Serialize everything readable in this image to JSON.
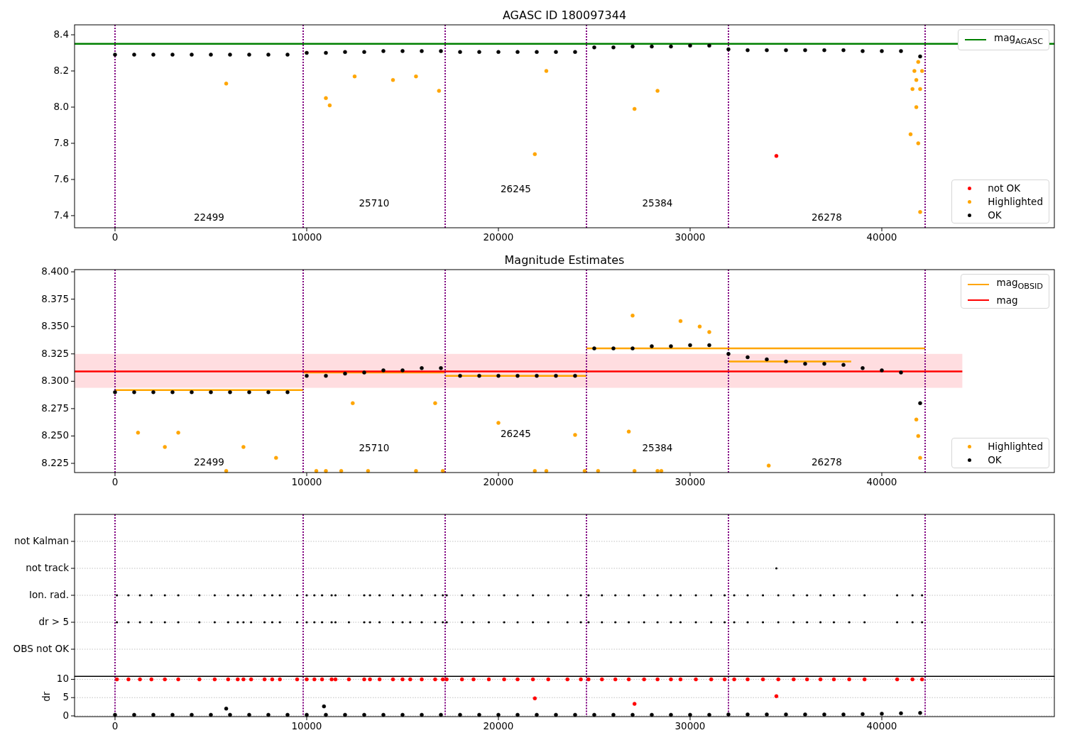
{
  "figure": {
    "panels": [
      {
        "chart_data": {
          "type": "scatter",
          "title": "AGASC ID 180097344",
          "xlim": [
            -2111,
            49000
          ],
          "ylim": [
            7.333,
            8.455
          ],
          "xticks": [
            {
              "value": 0,
              "label": "0"
            },
            {
              "value": 10000,
              "label": "10000"
            },
            {
              "value": 20000,
              "label": "20000"
            },
            {
              "value": 30000,
              "label": "30000"
            },
            {
              "value": 40000,
              "label": "40000"
            }
          ],
          "yticks": [
            {
              "value": 7.4,
              "label": "7.4"
            },
            {
              "value": 7.6,
              "label": "7.6"
            },
            {
              "value": 7.8,
              "label": "7.8"
            },
            {
              "value": 8.0,
              "label": "8.0"
            },
            {
              "value": 8.2,
              "label": "8.2"
            },
            {
              "value": 8.4,
              "label": "8.4"
            }
          ],
          "series": [
            {
              "name": "mag$_{AGASC}$",
              "type": "line",
              "color": "#008000",
              "x": [
                -2111,
                49000
              ],
              "values": [
                8.35,
                8.35
              ]
            },
            {
              "name": "not OK",
              "type": "scatter",
              "color": "#ff0000",
              "x": [
                34500
              ],
              "values": [
                7.73
              ]
            },
            {
              "name": "Highlighted",
              "type": "scatter",
              "color": "#ffa500",
              "x": [
                5800,
                11000,
                11200,
                12500,
                14500,
                15700,
                16900,
                21900,
                22500,
                27100,
                28300,
                41500,
                41600,
                41700,
                41800,
                41800,
                41900,
                41900,
                42000,
                42000,
                42100
              ],
              "values": [
                8.13,
                8.05,
                8.01,
                8.17,
                8.15,
                8.17,
                8.09,
                7.74,
                8.2,
                7.99,
                8.09,
                7.85,
                8.1,
                8.2,
                8.0,
                8.15,
                7.8,
                8.25,
                7.42,
                8.1,
                8.2
              ]
            },
            {
              "name": "OK",
              "type": "scatter",
              "color": "#000000",
              "x": [
                0,
                1000,
                2000,
                3000,
                4000,
                5000,
                6000,
                7000,
                8000,
                9000,
                10000,
                11000,
                12000,
                13000,
                14000,
                15000,
                16000,
                17000,
                18000,
                19000,
                20000,
                21000,
                22000,
                23000,
                24000,
                25000,
                26000,
                27000,
                28000,
                29000,
                30000,
                31000,
                32000,
                33000,
                34000,
                35000,
                36000,
                37000,
                38000,
                39000,
                40000,
                41000,
                42000
              ],
              "values": [
                8.29,
                8.29,
                8.29,
                8.29,
                8.29,
                8.29,
                8.29,
                8.29,
                8.29,
                8.29,
                8.3,
                8.3,
                8.305,
                8.305,
                8.31,
                8.31,
                8.31,
                8.31,
                8.305,
                8.305,
                8.305,
                8.305,
                8.305,
                8.305,
                8.305,
                8.33,
                8.33,
                8.335,
                8.335,
                8.335,
                8.34,
                8.34,
                8.32,
                8.315,
                8.315,
                8.315,
                8.315,
                8.315,
                8.315,
                8.31,
                8.31,
                8.31,
                8.28
              ]
            }
          ],
          "ref_lines": [
            {
              "axis": "x",
              "value": 0,
              "color": "#800080"
            },
            {
              "axis": "x",
              "value": 9815,
              "color": "#800080"
            },
            {
              "axis": "x",
              "value": 17222,
              "color": "#800080"
            },
            {
              "axis": "x",
              "value": 24593,
              "color": "#800080"
            },
            {
              "axis": "x",
              "value": 32000,
              "color": "#800080"
            },
            {
              "axis": "x",
              "value": 42259,
              "color": "#800080"
            }
          ],
          "annotations": [
            "22499",
            "25710",
            "26245",
            "25384",
            "26278"
          ],
          "legend": true
        }
      },
      {
        "chart_data": {
          "type": "scatter",
          "title": "Magnitude Estimates",
          "xlim": [
            -2111,
            49000
          ],
          "ylim": [
            8.2166,
            8.402
          ],
          "xticks": [
            {
              "value": 0,
              "label": "0"
            },
            {
              "value": 10000,
              "label": "10000"
            },
            {
              "value": 20000,
              "label": "20000"
            },
            {
              "value": 30000,
              "label": "30000"
            },
            {
              "value": 40000,
              "label": "40000"
            }
          ],
          "yticks": [
            {
              "value": 8.225,
              "label": "8.225"
            },
            {
              "value": 8.25,
              "label": "8.250"
            },
            {
              "value": 8.275,
              "label": "8.275"
            },
            {
              "value": 8.3,
              "label": "8.300"
            },
            {
              "value": 8.325,
              "label": "8.325"
            },
            {
              "value": 8.35,
              "label": "8.350"
            },
            {
              "value": 8.375,
              "label": "8.375"
            },
            {
              "value": 8.4,
              "label": "8.400"
            }
          ],
          "series": [
            {
              "name": "mag$_{OBSID}$",
              "type": "line",
              "color": "#ffa500",
              "x": [
                0,
                9815,
                null,
                9815,
                17222,
                null,
                17222,
                24593,
                null,
                24593,
                32000,
                null,
                32000,
                42259,
                null,
                32000,
                38400
              ],
              "values": [
                8.292,
                8.292,
                null,
                8.308,
                8.308,
                null,
                8.305,
                8.305,
                null,
                8.33,
                8.33,
                null,
                8.33,
                8.33,
                null,
                8.318,
                8.318
              ]
            },
            {
              "name": "mag",
              "type": "line",
              "color": "#ff0000",
              "x": [
                -2111,
                44200
              ],
              "values": [
                8.309,
                8.309
              ]
            },
            {
              "name": "Highlighted",
              "type": "scatter",
              "color": "#ffa500",
              "x": [
                1200,
                2600,
                3300,
                5800,
                6700,
                8400,
                10500,
                11000,
                11800,
                12400,
                13200,
                15700,
                16700,
                17100,
                20000,
                21900,
                22500,
                24000,
                24500,
                25200,
                26800,
                27000,
                27100,
                28300,
                28500,
                29500,
                30500,
                31000,
                34100,
                41800,
                41900,
                42000
              ],
              "values": [
                8.253,
                8.24,
                8.253,
                8.218,
                8.24,
                8.23,
                8.218,
                8.218,
                8.218,
                8.28,
                8.218,
                8.218,
                8.28,
                8.218,
                8.262,
                8.218,
                8.218,
                8.251,
                8.218,
                8.218,
                8.254,
                8.36,
                8.218,
                8.218,
                8.218,
                8.355,
                8.35,
                8.345,
                8.223,
                8.265,
                8.25,
                8.23
              ]
            },
            {
              "name": "OK",
              "type": "scatter",
              "color": "#000000",
              "x": [
                0,
                1000,
                2000,
                3000,
                4000,
                5000,
                6000,
                7000,
                8000,
                9000,
                10000,
                11000,
                12000,
                13000,
                14000,
                15000,
                16000,
                17000,
                18000,
                19000,
                20000,
                21000,
                22000,
                23000,
                24000,
                25000,
                26000,
                27000,
                28000,
                29000,
                30000,
                31000,
                32000,
                33000,
                34000,
                35000,
                36000,
                37000,
                38000,
                39000,
                40000,
                41000,
                42000
              ],
              "values": [
                8.29,
                8.29,
                8.29,
                8.29,
                8.29,
                8.29,
                8.29,
                8.29,
                8.29,
                8.29,
                8.305,
                8.305,
                8.307,
                8.308,
                8.31,
                8.31,
                8.312,
                8.312,
                8.305,
                8.305,
                8.305,
                8.305,
                8.305,
                8.305,
                8.305,
                8.33,
                8.33,
                8.33,
                8.332,
                8.332,
                8.333,
                8.333,
                8.325,
                8.322,
                8.32,
                8.318,
                8.316,
                8.316,
                8.315,
                8.312,
                8.31,
                8.308,
                8.28
              ]
            }
          ],
          "bands": [
            {
              "axis": "y",
              "from": 8.294,
              "to": 8.325,
              "color": "#ffdde0"
            }
          ],
          "ref_lines": [
            {
              "axis": "x",
              "value": 0,
              "color": "#800080"
            },
            {
              "axis": "x",
              "value": 9815,
              "color": "#800080"
            },
            {
              "axis": "x",
              "value": 17222,
              "color": "#800080"
            },
            {
              "axis": "x",
              "value": 24593,
              "color": "#800080"
            },
            {
              "axis": "x",
              "value": 32000,
              "color": "#800080"
            },
            {
              "axis": "x",
              "value": 42259,
              "color": "#800080"
            }
          ],
          "annotations": [
            "22499",
            "25710",
            "26245",
            "25384",
            "26278"
          ],
          "legend": true
        }
      },
      {
        "flag_rows": [
          {
            "label": "not Kalman",
            "kind": "empty"
          },
          {
            "label": "not track",
            "kind": "single"
          },
          {
            "label": "Ion. rad.",
            "kind": "periodic"
          },
          {
            "label": "dr > 5",
            "kind": "periodic"
          },
          {
            "label": "OBS not OK",
            "kind": "empty"
          }
        ]
      },
      {
        "chart_data": {
          "type": "scatter",
          "grid": true,
          "ylabel": "dr",
          "xlim": [
            -2111,
            49000
          ],
          "ylim": [
            -0.2,
            10.77
          ],
          "xticks": [
            {
              "value": 0,
              "label": "0"
            },
            {
              "value": 10000,
              "label": "10000"
            },
            {
              "value": 20000,
              "label": "20000"
            },
            {
              "value": 30000,
              "label": "30000"
            },
            {
              "value": 40000,
              "label": "40000"
            }
          ],
          "yticks": [
            {
              "value": 0,
              "label": "0"
            },
            {
              "value": 5,
              "label": "5"
            },
            {
              "value": 10,
              "label": "10"
            }
          ],
          "series": [
            {
              "color": "#000000",
              "x": [
                0,
                1000,
                2000,
                3000,
                4000,
                5000,
                6000,
                7000,
                8000,
                9000,
                10000,
                11000,
                12000,
                13000,
                14000,
                15000,
                16000,
                17000,
                18000,
                19000,
                20000,
                21000,
                22000,
                23000,
                24000,
                25000,
                26000,
                27000,
                28000,
                29000,
                30000,
                31000,
                32000,
                33000,
                34000,
                35000,
                36000,
                37000,
                38000,
                39000,
                40000,
                41000,
                42000,
                5800,
                10900
              ],
              "values": [
                0.3,
                0.3,
                0.3,
                0.3,
                0.3,
                0.3,
                0.3,
                0.3,
                0.3,
                0.3,
                0.3,
                0.3,
                0.3,
                0.3,
                0.3,
                0.3,
                0.3,
                0.3,
                0.3,
                0.3,
                0.3,
                0.3,
                0.3,
                0.3,
                0.3,
                0.3,
                0.3,
                0.3,
                0.3,
                0.3,
                0.3,
                0.3,
                0.4,
                0.4,
                0.4,
                0.4,
                0.4,
                0.4,
                0.4,
                0.5,
                0.6,
                0.7,
                0.8,
                2.0,
                2.6
              ]
            },
            {
              "color": "#ff0000",
              "x": [
                100,
                700,
                1300,
                1900,
                2600,
                3300,
                4400,
                5200,
                5900,
                6400,
                6700,
                7100,
                7800,
                8200,
                8600,
                9500,
                10000,
                10400,
                10800,
                11300,
                11500,
                12200,
                13000,
                13300,
                13800,
                14500,
                15000,
                15400,
                16000,
                16700,
                17100,
                17300,
                18100,
                18700,
                19500,
                20300,
                21000,
                21800,
                22600,
                23600,
                24300,
                24700,
                25400,
                26100,
                26800,
                27600,
                28300,
                29000,
                29500,
                30300,
                31100,
                31800,
                32300,
                33000,
                33800,
                34600,
                35400,
                36100,
                36800,
                37500,
                38300,
                39100,
                40800,
                41600,
                42100,
                21900,
                27100,
                34500
              ],
              "values": [
                10,
                10,
                10,
                10,
                10,
                10,
                10,
                10,
                10,
                10,
                10,
                10,
                10,
                10,
                10,
                10,
                10,
                10,
                10,
                10,
                10,
                10,
                10,
                10,
                10,
                10,
                10,
                10,
                10,
                10,
                10,
                10,
                10,
                10,
                10,
                10,
                10,
                10,
                10,
                10,
                10,
                10,
                10,
                10,
                10,
                10,
                10,
                10,
                10,
                10,
                10,
                10,
                10,
                10,
                10,
                10,
                10,
                10,
                10,
                10,
                10,
                10,
                10,
                10,
                10,
                4.8,
                3.3,
                5.4
              ]
            }
          ],
          "ref_lines": [
            {
              "axis": "x",
              "value": 0,
              "color": "#800080"
            },
            {
              "axis": "x",
              "value": 9815,
              "color": "#800080"
            },
            {
              "axis": "x",
              "value": 17222,
              "color": "#800080"
            },
            {
              "axis": "x",
              "value": 24593,
              "color": "#800080"
            },
            {
              "axis": "x",
              "value": 32000,
              "color": "#800080"
            },
            {
              "axis": "x",
              "value": 42259,
              "color": "#800080"
            }
          ]
        }
      }
    ]
  }
}
